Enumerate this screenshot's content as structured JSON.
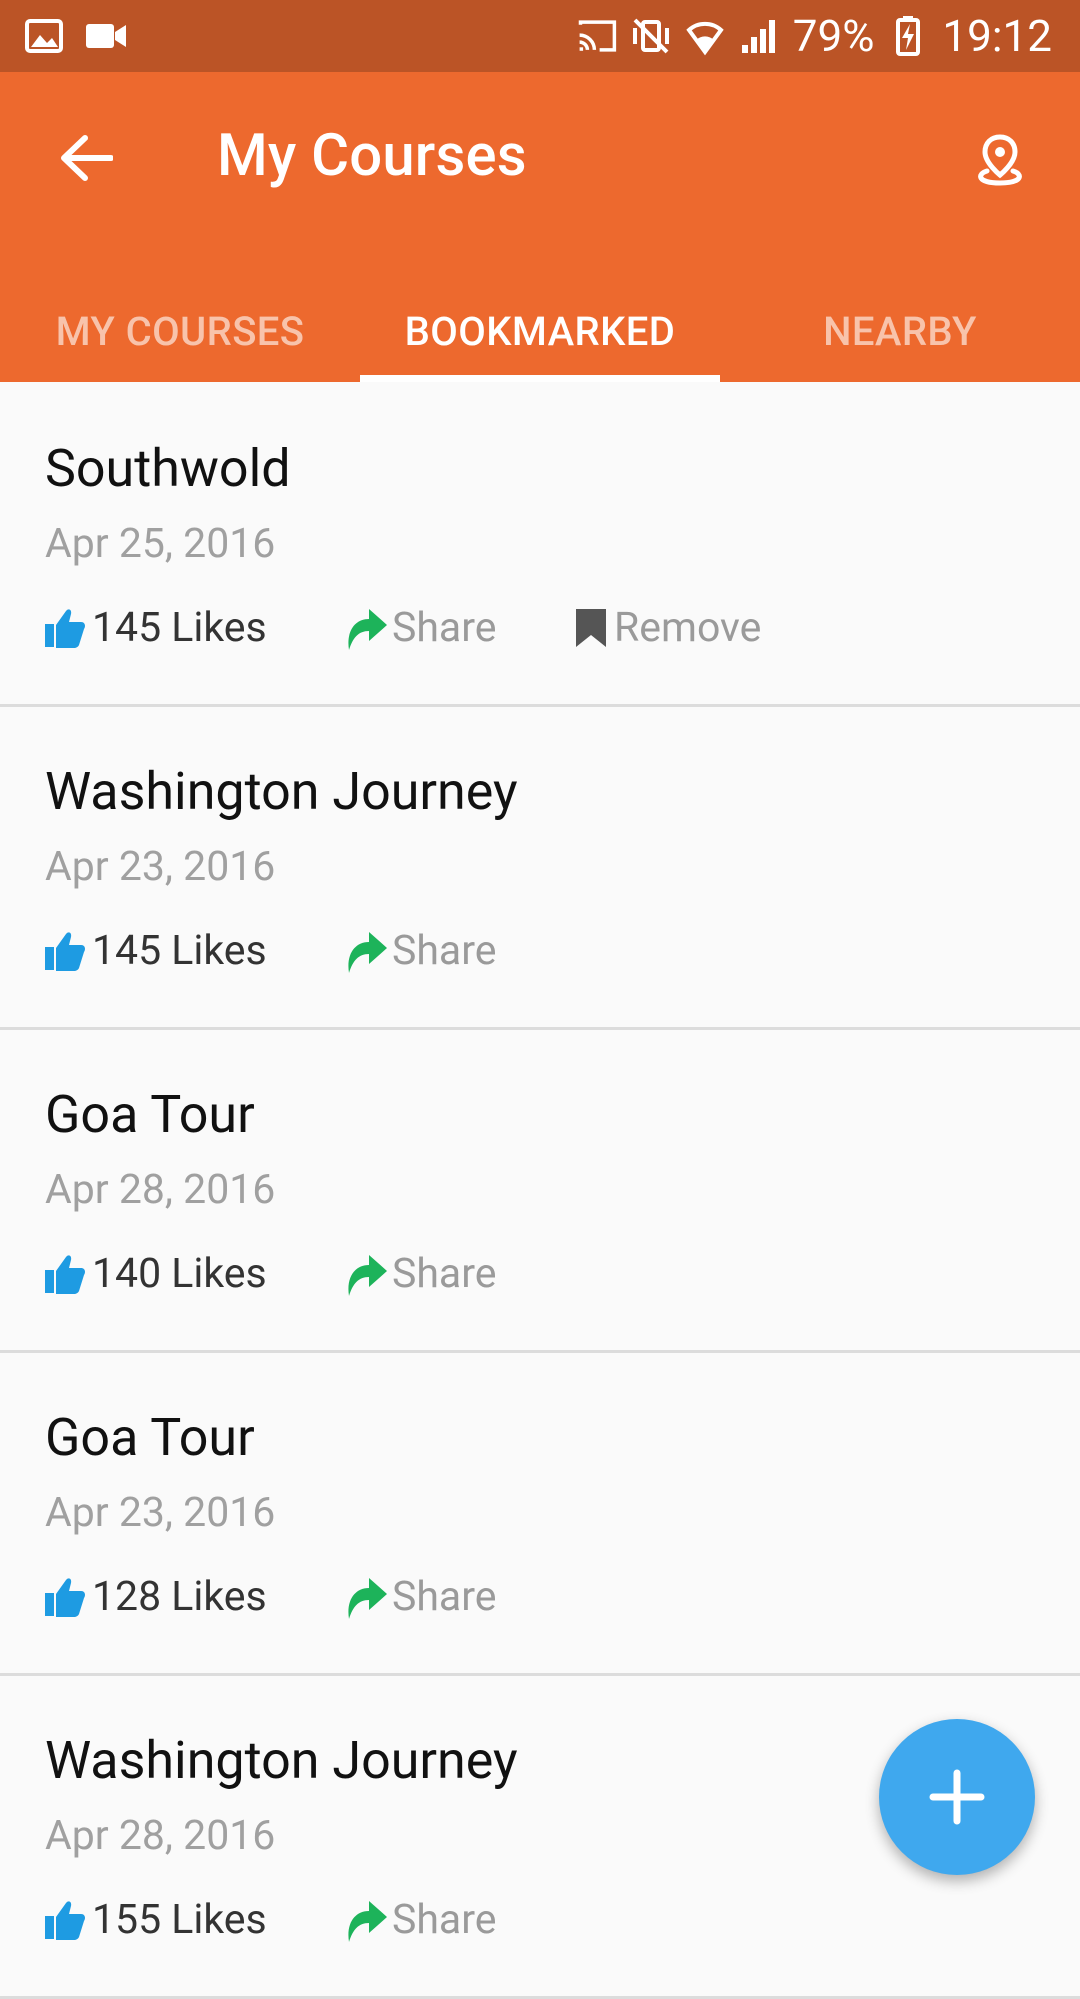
{
  "status_bar": {
    "battery": "79%",
    "time": "19:12"
  },
  "app_bar": {
    "title": "My Courses",
    "back_icon": "arrow-back-icon",
    "action_icon": "map-pin-icon"
  },
  "tabs": [
    {
      "label": "MY COURSES",
      "active": false
    },
    {
      "label": "BOOKMARKED",
      "active": true
    },
    {
      "label": "NEARBY",
      "active": false
    }
  ],
  "courses": [
    {
      "title": "Southwold",
      "date": "Apr 25, 2016",
      "likes": "145 Likes",
      "share": "Share",
      "remove": "Remove"
    },
    {
      "title": "Washington Journey",
      "date": "Apr 23, 2016",
      "likes": "145 Likes",
      "share": "Share"
    },
    {
      "title": "Goa Tour",
      "date": "Apr 28, 2016",
      "likes": "140 Likes",
      "share": "Share"
    },
    {
      "title": "Goa Tour",
      "date": "Apr 23, 2016",
      "likes": "128 Likes",
      "share": "Share"
    },
    {
      "title": "Washington Journey",
      "date": "Apr 28, 2016",
      "likes": "155 Likes",
      "share": "Share"
    }
  ],
  "fab": {
    "icon": "plus-icon"
  },
  "colors": {
    "status_bar": "#bb5426",
    "app_bar": "#ed692e",
    "like_icon": "#1e9be2",
    "share_icon": "#1db35a",
    "fab": "#3fa8ee"
  }
}
